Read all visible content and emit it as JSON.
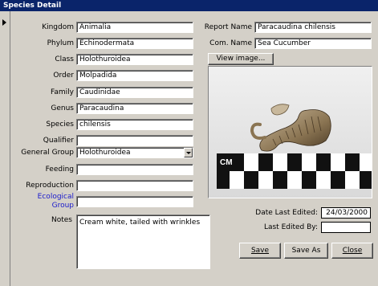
{
  "window": {
    "title": "Species Detail"
  },
  "left_fields": [
    {
      "label": "Kingdom",
      "value": "Animalia"
    },
    {
      "label": "Phylum",
      "value": "Echinodermata"
    },
    {
      "label": "Class",
      "value": "Holothuroidea"
    },
    {
      "label": "Order",
      "value": "Molpadida"
    },
    {
      "label": "Family",
      "value": "Caudinidae"
    },
    {
      "label": "Genus",
      "value": "Paracaudina"
    },
    {
      "label": "Species",
      "value": "chilensis"
    },
    {
      "label": "Qualifier",
      "value": ""
    },
    {
      "label": "General Group",
      "value": "Holothuroidea"
    },
    {
      "label": "Feeding",
      "value": ""
    },
    {
      "label": "Reproduction",
      "value": ""
    },
    {
      "label": "Ecological Group",
      "value": ""
    }
  ],
  "ecological_label_line1": "Ecological",
  "ecological_label_line2": "Group",
  "report_name": {
    "label": "Report Name",
    "value": "Paracaudina chilensis"
  },
  "com_name": {
    "label": "Com. Name",
    "value": "Sea Cucumber"
  },
  "view_image_button": "View image...",
  "photo": {
    "scale_label": "CM"
  },
  "notes": {
    "label": "Notes",
    "value": "Cream white, tailed with wrinkles"
  },
  "date_last_edited": {
    "label": "Date Last Edited:",
    "value": "24/03/2000"
  },
  "last_edited_by": {
    "label": "Last Edited By:",
    "value": ""
  },
  "buttons": {
    "save": "Save",
    "save_as": "Save As",
    "close": "Close"
  },
  "colors": {
    "titlebar": "#0a246a",
    "form_bg": "#d4d0c8",
    "link_label": "#1a1acc"
  }
}
